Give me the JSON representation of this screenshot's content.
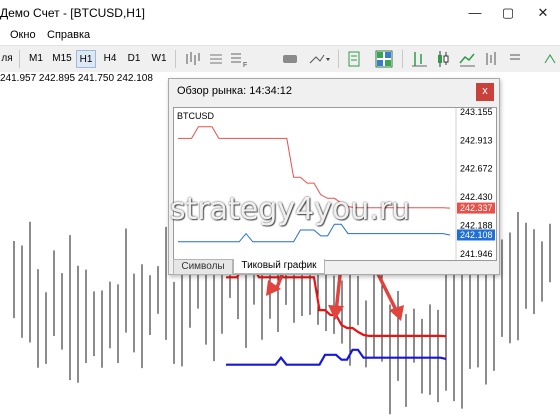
{
  "window": {
    "title": "Демо Счет - [BTCUSD,H1]",
    "controls": {
      "minimize": "—",
      "restore": "▢",
      "close": "✕"
    }
  },
  "menu": {
    "items": [
      "Окно",
      "Справка"
    ]
  },
  "toolbar": {
    "partial_left": "ля",
    "timeframes": [
      "M1",
      "M15",
      "H1",
      "H4",
      "D1",
      "W1"
    ],
    "active_timeframe": "H1",
    "icons": [
      "bar-chart-lines-icon",
      "template-icon",
      "chart-shift-icon",
      "drawing-tools-icon",
      "color-scheme-icon",
      "tile-windows-icon",
      "bar-chart-icon",
      "candlestick-icon",
      "line-chart-icon",
      "chart-settings-icon"
    ]
  },
  "chart": {
    "ohlc": "241.957 242.895 241.750 242.108"
  },
  "market_watch": {
    "title": "Обзор рынка: 14:34:12",
    "close_glyph": "x",
    "symbol": "BTCUSD",
    "tabs": [
      "Символы",
      "Тиковый график"
    ],
    "active_tab": "Тиковый график",
    "price_labels": [
      "243.155",
      "242.913",
      "242.672",
      "242.430",
      "242.188",
      "241.946"
    ],
    "ask_marker": "242.337",
    "bid_marker": "242.108",
    "colors": {
      "ask": "#e8504a",
      "bid": "#1f6fd6"
    }
  },
  "chart_data": {
    "type": "line",
    "title": "BTCUSD",
    "ylim": [
      241.946,
      243.155
    ],
    "series": [
      {
        "values": [
          242.93,
          242.93,
          242.93,
          243.03,
          243.03,
          243.03,
          242.93,
          242.93,
          242.93,
          242.93,
          242.93,
          242.93,
          242.93,
          242.93,
          242.93,
          242.93,
          242.93,
          242.6,
          242.6,
          242.55,
          242.55,
          242.45,
          242.42,
          242.42,
          242.38,
          242.35,
          242.34,
          242.34,
          242.34,
          242.34,
          242.34,
          242.34,
          242.34,
          242.34,
          242.34,
          242.34,
          242.34,
          242.34,
          242.34,
          242.34,
          242.337
        ]
      },
      {
        "values": [
          242.05,
          242.05,
          242.05,
          242.05,
          242.05,
          242.05,
          242.05,
          242.05,
          242.05,
          242.05,
          242.12,
          242.05,
          242.05,
          242.05,
          242.05,
          242.05,
          242.05,
          242.05,
          242.15,
          242.15,
          242.15,
          242.1,
          242.1,
          242.2,
          242.2,
          242.12,
          242.12,
          242.12,
          242.12,
          242.12,
          242.12,
          242.12,
          242.12,
          242.12,
          242.12,
          242.12,
          242.12,
          242.12,
          242.12,
          242.12,
          242.108
        ]
      }
    ]
  },
  "annotation": {
    "watermark": "strategy4you.ru"
  }
}
